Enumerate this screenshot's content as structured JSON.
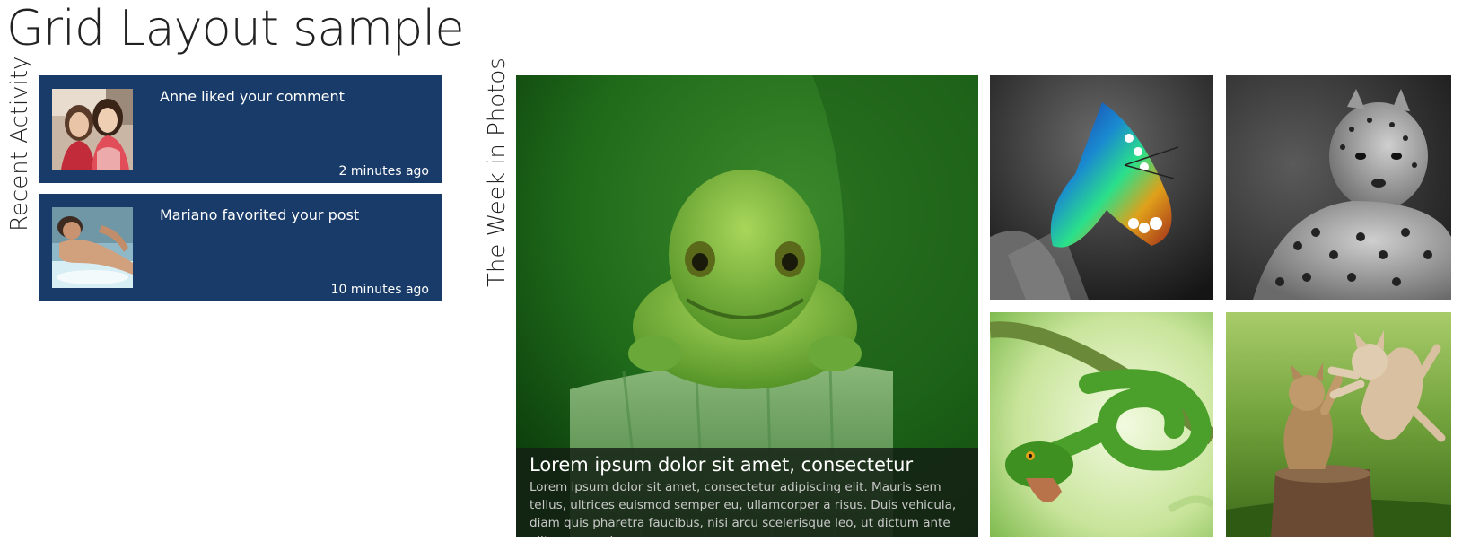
{
  "page": {
    "title": "Grid Layout sample"
  },
  "recent_activity": {
    "heading": "Recent Activity",
    "items": [
      {
        "message": "Anne liked your comment",
        "time": "2 minutes ago",
        "avatar_icon": "two-women-photo"
      },
      {
        "message": "Mariano favorited your post",
        "time": "10 minutes ago",
        "avatar_icon": "man-in-pool-photo"
      }
    ]
  },
  "photos": {
    "heading": "The Week in Photos",
    "featured": {
      "image": "green-frog-photo",
      "caption_title": "Lorem ipsum dolor sit amet, consectetur",
      "caption_body": "Lorem ipsum dolor sit amet, consectetur adipiscing elit. Mauris sem tellus, ultrices euismod semper eu, ullamcorper a risus. Duis vehicula, diam quis pharetra faucibus, nisi arcu scelerisque leo, ut dictum ante elit nec mauris."
    },
    "thumbnails": [
      {
        "image": "butterfly-photo"
      },
      {
        "image": "leopard-photo"
      },
      {
        "image": "green-snake-photo"
      },
      {
        "image": "kittens-photo"
      }
    ]
  },
  "colors": {
    "tile_background": "#183b69",
    "page_background": "#ffffff",
    "caption_background": "#141e14"
  }
}
